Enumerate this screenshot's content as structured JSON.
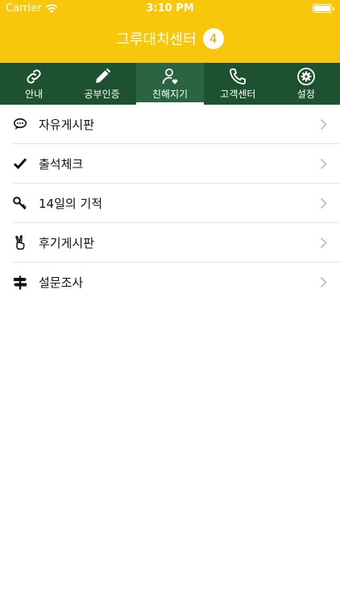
{
  "status_bar": {
    "carrier": "Carrier",
    "time": "3:10 PM"
  },
  "nav": {
    "title": "그루대치센터",
    "badge": "4"
  },
  "tabs": [
    {
      "label": "안내",
      "icon": "link-icon"
    },
    {
      "label": "공부인증",
      "icon": "pencil-icon"
    },
    {
      "label": "친해지기",
      "icon": "person-heart-icon",
      "active": true
    },
    {
      "label": "고객센터",
      "icon": "phone-icon"
    },
    {
      "label": "설정",
      "icon": "gear-icon"
    }
  ],
  "menu": [
    {
      "label": "자유게시판",
      "icon": "speech-bubble-icon"
    },
    {
      "label": "출석체크",
      "icon": "checkmark-icon"
    },
    {
      "label": "14일의 기적",
      "icon": "key-icon"
    },
    {
      "label": "후기게시판",
      "icon": "victory-hand-icon"
    },
    {
      "label": "설문조사",
      "icon": "signpost-icon"
    }
  ],
  "colors": {
    "header": "#F8C60A",
    "tabbar": "#1D5130",
    "tab_active": "#2A6440"
  }
}
